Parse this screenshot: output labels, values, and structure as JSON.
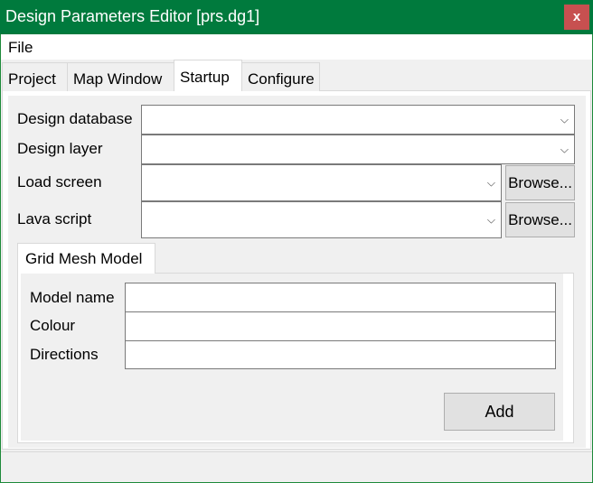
{
  "window": {
    "title": "Design Parameters Editor [prs.dg1]",
    "close_label": "x"
  },
  "menu": {
    "file": "File"
  },
  "tabs": [
    {
      "label": "Project"
    },
    {
      "label": "Map Window"
    },
    {
      "label": "Startup",
      "active": true
    },
    {
      "label": "Configure"
    }
  ],
  "startup": {
    "design_database": {
      "label": "Design database",
      "value": ""
    },
    "design_layer": {
      "label": "Design layer",
      "value": ""
    },
    "load_screen": {
      "label": "Load screen",
      "value": "",
      "browse": "Browse..."
    },
    "lava_script": {
      "label": "Lava script",
      "value": "",
      "browse": "Browse..."
    },
    "chevron": "⌵"
  },
  "grid_mesh": {
    "tab_label": "Grid Mesh Model",
    "model_name": {
      "label": "Model name",
      "value": ""
    },
    "colour": {
      "label": "Colour",
      "value": ""
    },
    "directions": {
      "label": "Directions",
      "value": ""
    },
    "add_label": "Add"
  }
}
